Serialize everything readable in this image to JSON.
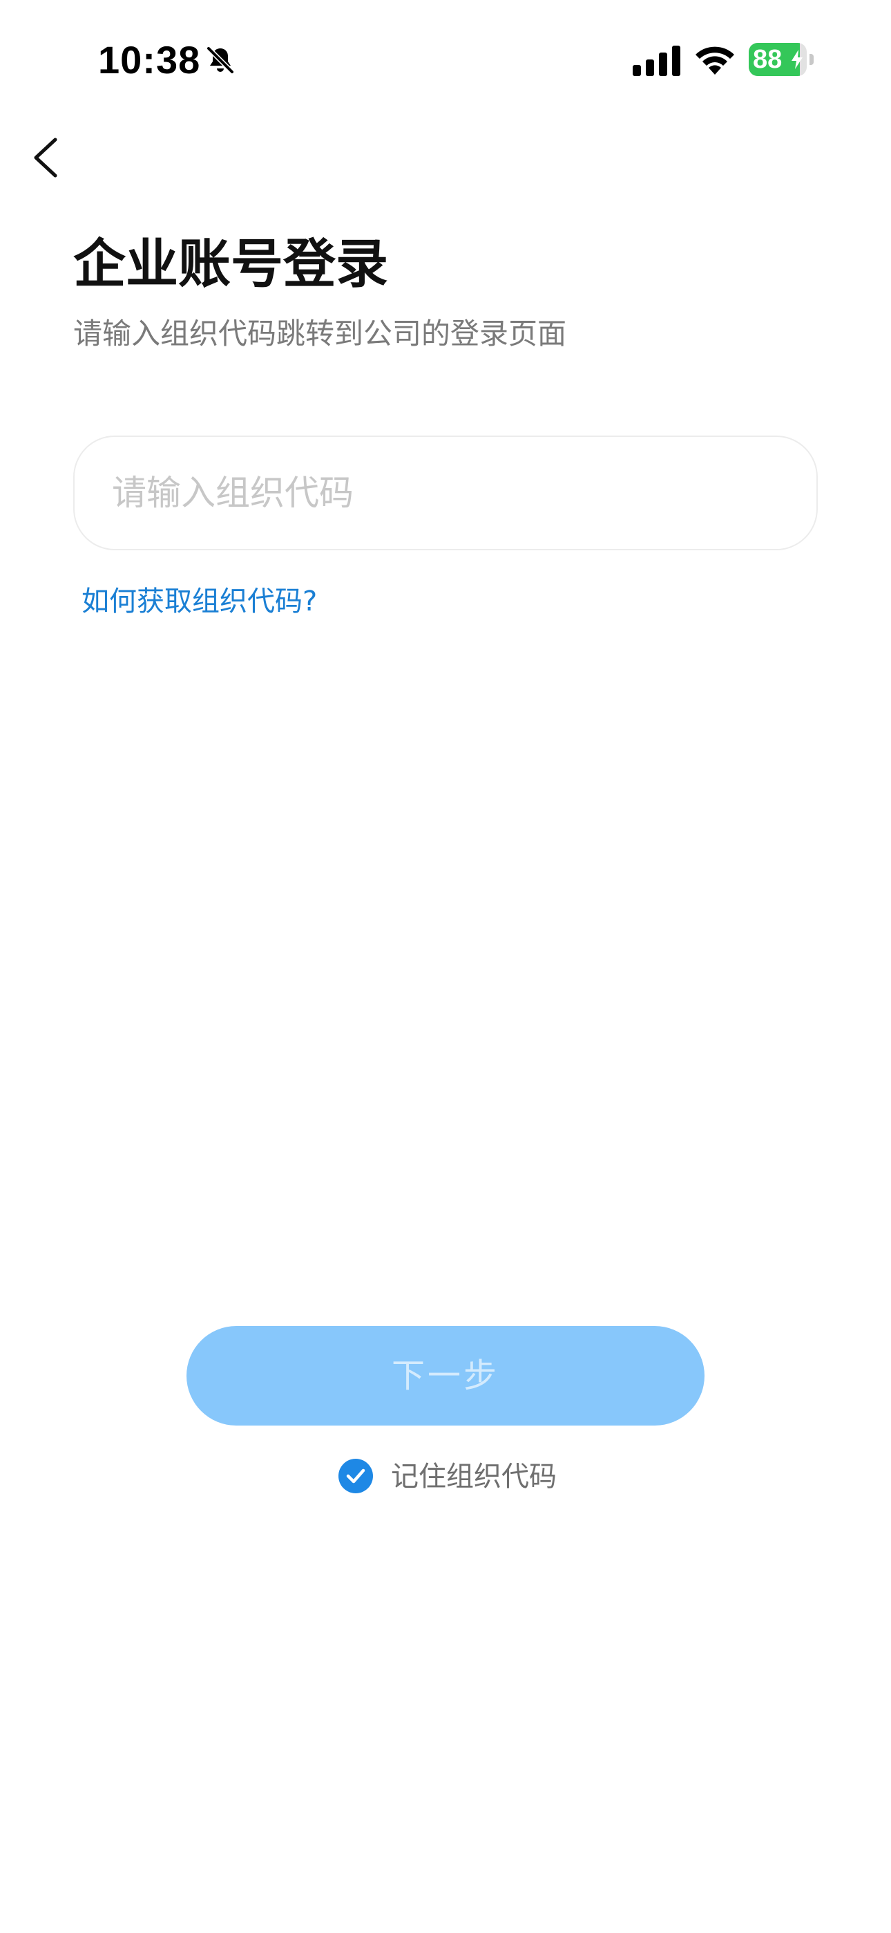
{
  "status_bar": {
    "time": "10:38",
    "battery_percent": "88",
    "battery_level": 0.88,
    "icons": [
      "bell-slash-icon",
      "cellular-signal-icon",
      "wifi-icon",
      "battery-charging-icon"
    ]
  },
  "header": {
    "back_icon": "chevron-left-icon",
    "title": "企业账号登录",
    "subtitle": "请输入组织代码跳转到公司的登录页面"
  },
  "form": {
    "org_code_value": "",
    "org_code_placeholder": "请输入组织代码",
    "help_link": "如何获取组织代码?"
  },
  "actions": {
    "next_label": "下一步",
    "remember_label": "记住组织代码",
    "remember_checked": true
  },
  "colors": {
    "accent": "#1e88e5",
    "link": "#1a7fd4",
    "button_disabled": "#87c7fb",
    "battery_green": "#34c759"
  }
}
